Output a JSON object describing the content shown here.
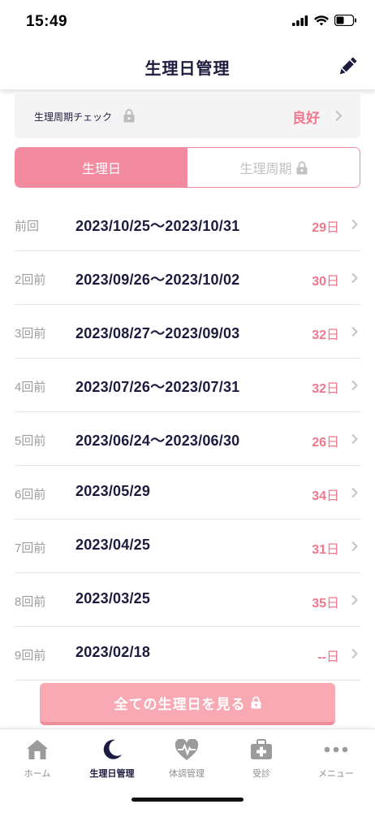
{
  "status_bar": {
    "time": "15:49"
  },
  "header": {
    "title": "生理日管理",
    "edit_icon": "pencil-icon"
  },
  "cycle_check": {
    "label": "生理周期チェック",
    "value": "良好"
  },
  "segment": {
    "tabs": [
      "生理日",
      "生理周期"
    ],
    "active": 0
  },
  "periods": [
    {
      "label": "前回",
      "dates": "2023/10/25〜2023/10/31",
      "days": "29",
      "unit": "日"
    },
    {
      "label": "2回前",
      "dates": "2023/09/26〜2023/10/02",
      "days": "30",
      "unit": "日"
    },
    {
      "label": "3回前",
      "dates": "2023/08/27〜2023/09/03",
      "days": "32",
      "unit": "日"
    },
    {
      "label": "4回前",
      "dates": "2023/07/26〜2023/07/31",
      "days": "32",
      "unit": "日"
    },
    {
      "label": "5回前",
      "dates": "2023/06/24〜2023/06/30",
      "days": "26",
      "unit": "日"
    },
    {
      "label": "6回前",
      "dates": "2023/05/29",
      "days": "34",
      "unit": "日"
    },
    {
      "label": "7回前",
      "dates": "2023/04/25",
      "days": "31",
      "unit": "日"
    },
    {
      "label": "8回前",
      "dates": "2023/03/25",
      "days": "35",
      "unit": "日"
    },
    {
      "label": "9回前",
      "dates": "2023/02/18",
      "days": "--",
      "unit": "日"
    }
  ],
  "all_button": {
    "label": "全ての生理日を見る"
  },
  "tab_bar": {
    "items": [
      {
        "label": "ホーム",
        "icon": "home-icon"
      },
      {
        "label": "生理日管理",
        "icon": "moon-icon"
      },
      {
        "label": "体調管理",
        "icon": "heart-pulse-icon"
      },
      {
        "label": "受診",
        "icon": "medical-kit-icon"
      },
      {
        "label": "メニュー",
        "icon": "more-icon"
      }
    ],
    "active": 1
  },
  "colors": {
    "accent": "#f38ba0",
    "accent_text": "#f0778c",
    "navy": "#1d1b3f",
    "button": "#f9a9b3"
  }
}
